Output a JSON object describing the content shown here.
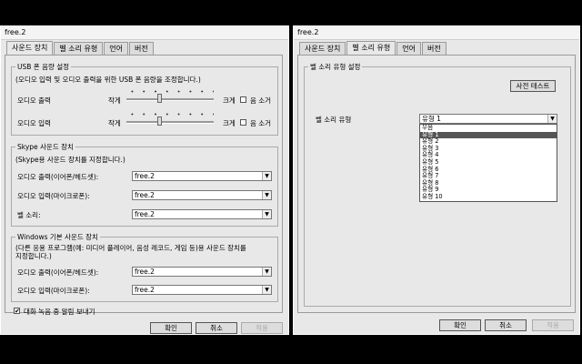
{
  "left": {
    "title": "free.2",
    "tabs": [
      "사운드 장치",
      "벨 소리 유형",
      "언어",
      "버전"
    ],
    "usb_group": {
      "title": "USB 폰 음량 설정",
      "desc": "(오디오 입력 및 오디오 출력을 위한 USB 폰 음량을 조정합니다.)",
      "rows": [
        {
          "label": "오디오 출력",
          "low": "작게",
          "high": "크게",
          "mute": "음 소거",
          "level": 0.37
        },
        {
          "label": "오디오 입력",
          "low": "작게",
          "high": "크게",
          "mute": "음 소거",
          "level": 0.37
        }
      ]
    },
    "skype_group": {
      "title": "Skype 사운드 장치",
      "desc": "(Skype용 사운드 장치를 지정합니다.)",
      "rows": [
        {
          "label": "오디오 출력(이어폰/헤드셋):",
          "value": "free.2"
        },
        {
          "label": "오디오 입력(마이크로폰):",
          "value": "free.2"
        },
        {
          "label": "벨 소리:",
          "value": "free.2"
        }
      ]
    },
    "windows_group": {
      "title": "Windows 기본 사운드 장치",
      "desc1": "(다른 응용 프로그램(예: 미디어 플레이어, 음성 레코드, 게임 등)용 사운드 장치를",
      "desc2": "지정합니다.)",
      "rows": [
        {
          "label": "오디오 출력(이어폰/헤드셋):",
          "value": "free.2"
        },
        {
          "label": "오디오 입력(마이크로폰):",
          "value": "free.2"
        }
      ]
    },
    "record_label": "대화 녹음 중 알림 보내기",
    "record_checked": true,
    "buttons": {
      "ok": "확인",
      "cancel": "취소",
      "apply": "적용"
    }
  },
  "right": {
    "title": "free.2",
    "tabs": [
      "사운드 장치",
      "벨 소리 유형",
      "언어",
      "버전"
    ],
    "group_title": "벨 소리 유형 설정",
    "test_button": "사전 테스트",
    "ring_label": "벨 소리 유형",
    "ring_value": "유형 1",
    "options": [
      "무음",
      "유형 1",
      "유형 2",
      "유형 3",
      "유형 4",
      "유형 5",
      "유형 6",
      "유형 7",
      "유형 8",
      "유형 9",
      "유형 10"
    ],
    "selected_index": 1,
    "buttons": {
      "ok": "확인",
      "cancel": "취소",
      "apply": "적용"
    }
  }
}
